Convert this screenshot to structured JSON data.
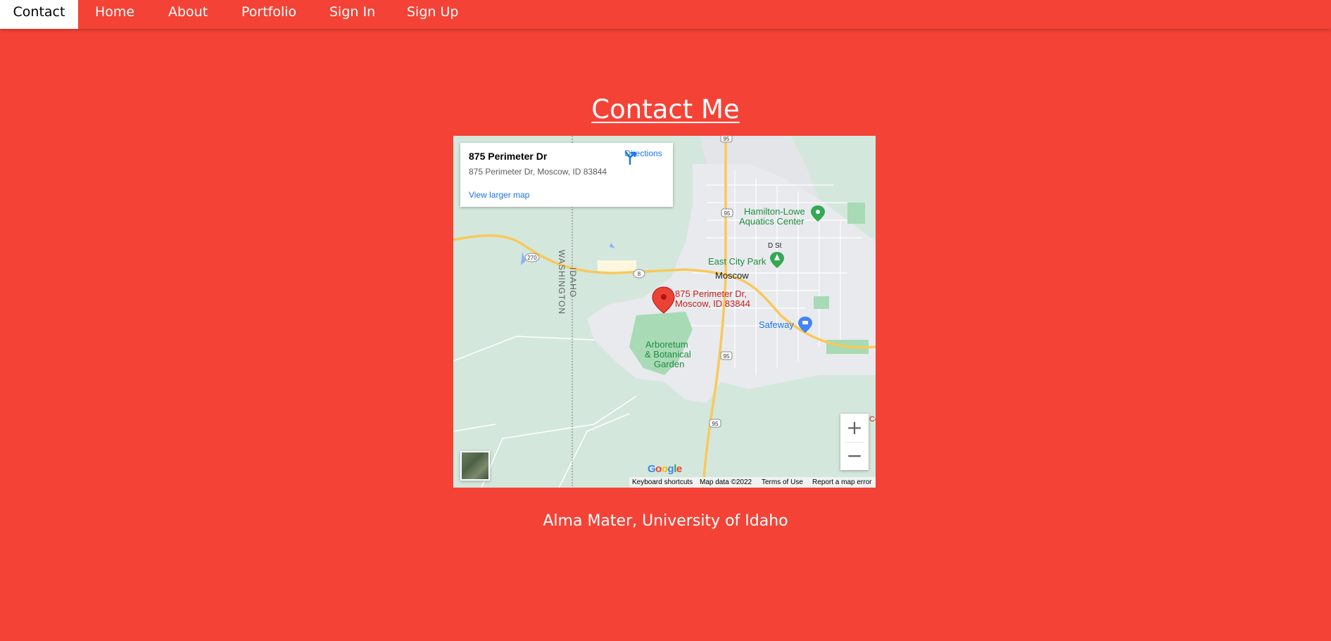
{
  "nav": {
    "items": [
      {
        "label": "Contact",
        "active": true
      },
      {
        "label": "Home",
        "active": false
      },
      {
        "label": "About",
        "active": false
      },
      {
        "label": "Portfolio",
        "active": false
      },
      {
        "label": "Sign In",
        "active": false
      },
      {
        "label": "Sign Up",
        "active": false
      }
    ]
  },
  "page": {
    "title": "Contact Me",
    "caption": "Alma Mater, University of Idaho"
  },
  "map": {
    "info": {
      "name": "875 Perimeter Dr",
      "address": "875 Perimeter Dr, Moscow, ID 83844",
      "directions_label": "Directions",
      "larger_map_label": "View larger map"
    },
    "labels": {
      "aquatics_line1": "Hamilton-Lowe",
      "aquatics_line2": "Aquatics Center",
      "d_st": "D St",
      "park": "East City Park",
      "city": "Moscow",
      "marker_line1": "875 Perimeter Dr,",
      "marker_line2": "Moscow, ID 83844",
      "store": "Safeway",
      "arboretum_line1": "Arboretum",
      "arboretum_line2": "& Botanical",
      "arboretum_line3": "Garden",
      "state_idaho": "IDAHO",
      "state_washington": "WASHINGTON",
      "edge_fragment": "Co"
    },
    "route_shields": [
      "95",
      "95",
      "95",
      "95",
      "270",
      "8"
    ],
    "zoom": {
      "in": "+",
      "out": "−"
    },
    "logo": [
      "G",
      "o",
      "o",
      "g",
      "l",
      "e"
    ],
    "attribution": {
      "keyboard": "Keyboard shortcuts",
      "data": "Map data ©2022",
      "terms": "Terms of Use",
      "report": "Report a map error"
    }
  },
  "colors": {
    "page_background": "#f44336",
    "nav_active_background": "#ffffff",
    "map_water_land": "#d4e7dc",
    "highway": "#f8c95a",
    "marker_red": "#ea4335",
    "link_blue": "#1a73e8",
    "poi_green": "#1e8e3e"
  }
}
